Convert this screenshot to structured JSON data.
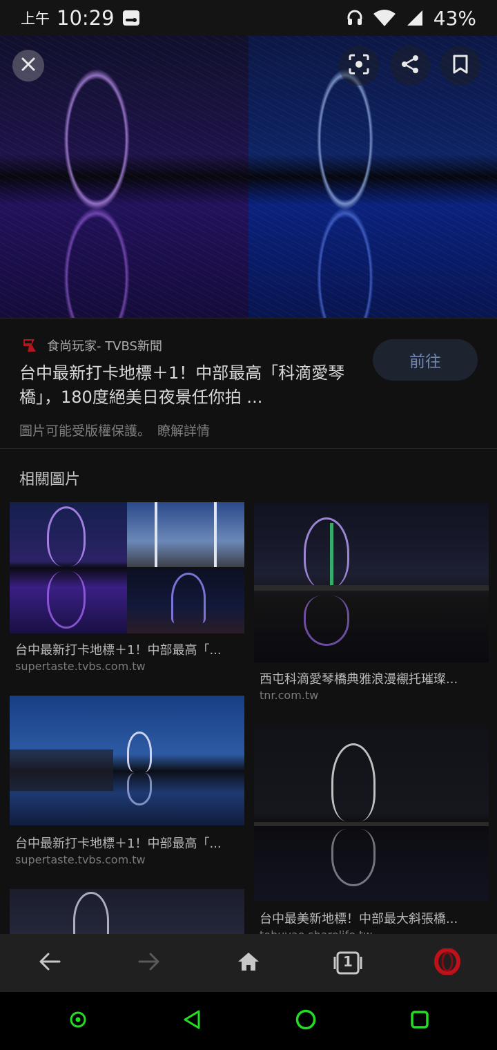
{
  "status_bar": {
    "ampm": "上午",
    "time": "10:29",
    "battery": "43%",
    "icons": [
      "message-icon",
      "headset-icon",
      "wifi-icon",
      "signal-icon"
    ]
  },
  "viewer": {
    "top_actions": [
      "close-icon",
      "lens-icon",
      "share-icon",
      "bookmark-icon"
    ]
  },
  "result": {
    "source_name": "食尚玩家- TVBS新聞",
    "title": "台中最新打卡地標＋1！中部最高「科滴愛琴橋」，180度絕美日夜景任你拍 ...",
    "visit_label": "前往",
    "copyright_text": "圖片可能受版權保護。",
    "learn_more": "瞭解詳情"
  },
  "related": {
    "heading": "相關圖片",
    "items": [
      {
        "title": "台中最新打卡地標＋1！中部最高「...",
        "domain": "supertaste.tvbs.com.tw"
      },
      {
        "title": "西屯科滴愛琴橋典雅浪漫襯托璀璨...",
        "domain": "tnr.com.tw"
      },
      {
        "title": "台中最新打卡地標＋1！中部最高「...",
        "domain": "supertaste.tvbs.com.tw"
      },
      {
        "title": "台中最美新地標！中部最大斜張橋...",
        "domain": "tobuyao.sharelife.tw"
      }
    ]
  },
  "toolbar": {
    "tab_count": "1",
    "icons": [
      "back-icon",
      "forward-icon",
      "home-icon",
      "tabs-icon",
      "opera-icon"
    ]
  },
  "colors": {
    "background": "#111111",
    "accent": "#6f86b5",
    "nav_green": "#22dd22",
    "opera_red": "#c0101a"
  }
}
